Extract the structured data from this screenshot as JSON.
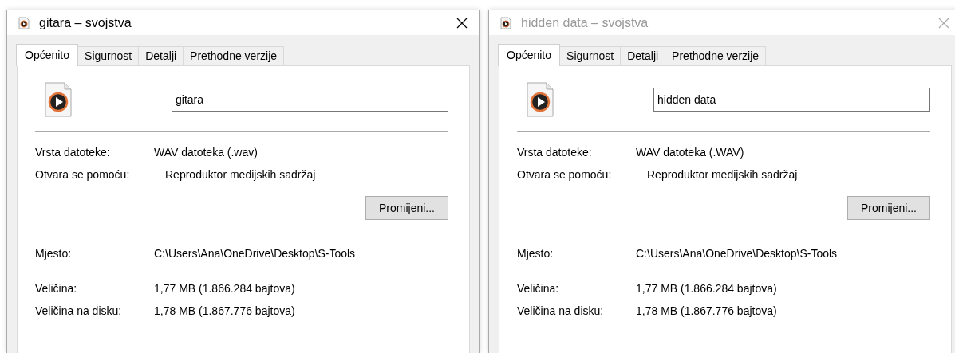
{
  "windows": [
    {
      "title": "gitara – svojstva",
      "active": true,
      "tabs": [
        {
          "label": "Općenito",
          "selected": true
        },
        {
          "label": "Sigurnost",
          "selected": false
        },
        {
          "label": "Detalji",
          "selected": false
        },
        {
          "label": "Prethodne verzije",
          "selected": false
        }
      ],
      "name_field": {
        "value": "gitara"
      },
      "sections": [
        {
          "rows": [
            {
              "kind": "text",
              "label": "Vrsta datoteke:",
              "value": "WAV datoteka (.wav)"
            },
            {
              "kind": "app",
              "label": "Otvara se pomoću:",
              "value": "Reproduktor medijskih sadržaj"
            }
          ],
          "button": "Promijeni..."
        },
        {
          "rows": [
            {
              "kind": "text",
              "label": "Mjesto:",
              "value": "C:\\Users\\Ana\\OneDrive\\Desktop\\S-Tools"
            },
            {
              "kind": "gap"
            },
            {
              "kind": "text",
              "label": "Veličina:",
              "value": "1,77 MB (1.866.284 bajtova)"
            },
            {
              "kind": "text",
              "label": "Veličina na disku:",
              "value": "1,78 MB (1.867.776 bajtova)"
            }
          ]
        }
      ]
    },
    {
      "title": "hidden data – svojstva",
      "active": false,
      "tabs": [
        {
          "label": "Općenito",
          "selected": true
        },
        {
          "label": "Sigurnost",
          "selected": false
        },
        {
          "label": "Detalji",
          "selected": false
        },
        {
          "label": "Prethodne verzije",
          "selected": false
        }
      ],
      "name_field": {
        "value": "hidden data"
      },
      "sections": [
        {
          "rows": [
            {
              "kind": "text",
              "label": "Vrsta datoteke:",
              "value": "WAV datoteka (.WAV)"
            },
            {
              "kind": "app",
              "label": "Otvara se pomoću:",
              "value": "Reproduktor medijskih sadržaj"
            }
          ],
          "button": "Promijeni..."
        },
        {
          "rows": [
            {
              "kind": "text",
              "label": "Mjesto:",
              "value": "C:\\Users\\Ana\\OneDrive\\Desktop\\S-Tools"
            },
            {
              "kind": "gap"
            },
            {
              "kind": "text",
              "label": "Veličina:",
              "value": "1,77 MB (1.866.284 bajtova)"
            },
            {
              "kind": "text",
              "label": "Veličina na disku:",
              "value": "1,78 MB (1.867.776 bajtova)"
            }
          ]
        }
      ]
    }
  ]
}
